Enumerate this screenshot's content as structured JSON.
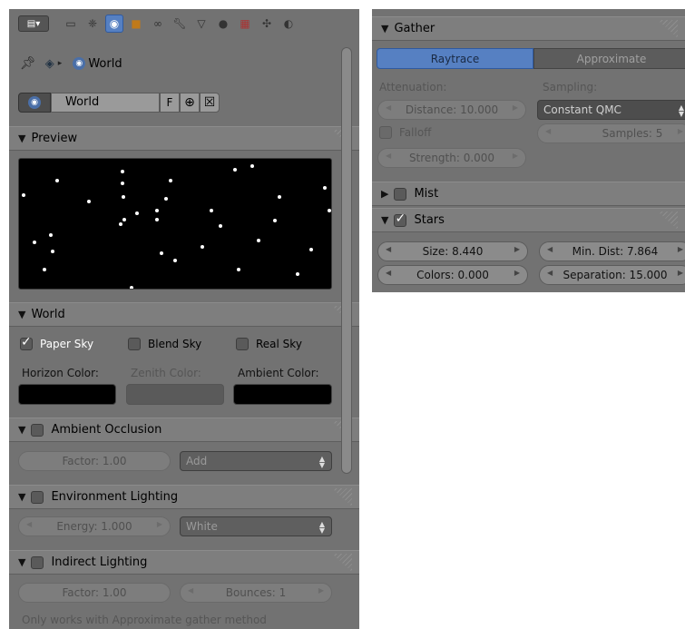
{
  "toolbar": {
    "tabs": [
      {
        "icon": "render-icon"
      },
      {
        "icon": "render-layers-icon"
      },
      {
        "icon": "scene-icon"
      },
      {
        "icon": "world-icon"
      },
      {
        "icon": "object-icon"
      },
      {
        "icon": "constraints-icon"
      },
      {
        "icon": "modifiers-icon"
      },
      {
        "icon": "mesh-data-icon"
      },
      {
        "icon": "material-icon"
      },
      {
        "icon": "texture-icon"
      },
      {
        "icon": "particles-icon"
      },
      {
        "icon": "physics-icon"
      }
    ],
    "active_tab": "world-icon"
  },
  "breadcrumb": {
    "item": "World"
  },
  "world_datablock": {
    "name": "World",
    "fake_user_label": "F"
  },
  "preview": {
    "title": "Preview"
  },
  "world": {
    "title": "World",
    "paper_sky": {
      "label": "Paper Sky",
      "checked": true
    },
    "blend_sky": {
      "label": "Blend Sky",
      "checked": false
    },
    "real_sky": {
      "label": "Real Sky",
      "checked": false
    },
    "horizon_label": "Horizon Color:",
    "zenith_label": "Zenith Color:",
    "ambient_label": "Ambient Color:",
    "colors": {
      "horizon": "#000000",
      "zenith": "#5a5a5a",
      "ambient": "#000000"
    }
  },
  "ambient_occlusion": {
    "title": "Ambient Occlusion",
    "factor": "Factor: 1.00",
    "blend": "Add"
  },
  "environment_lighting": {
    "title": "Environment Lighting",
    "energy": "Energy: 1.000",
    "color": "White"
  },
  "indirect_lighting": {
    "title": "Indirect Lighting",
    "factor": "Factor: 1.00",
    "bounces": "Bounces: 1",
    "note": "Only works with Approximate gather method"
  },
  "gather": {
    "title": "Gather",
    "tab_raytrace": "Raytrace",
    "tab_approximate": "Approximate",
    "attenuation_label": "Attenuation:",
    "sampling_label": "Sampling:",
    "distance": "Distance: 10.000",
    "sampling_method": "Constant QMC",
    "falloff_label": "Falloff",
    "samples": "Samples: 5",
    "strength": "Strength: 0.000"
  },
  "mist": {
    "title": "Mist",
    "checked": false
  },
  "stars": {
    "title": "Stars",
    "checked": true,
    "size": "Size: 8.440",
    "min_dist": "Min. Dist: 7.864",
    "colors": "Colors: 0.000",
    "separation": "Separation: 15.000"
  },
  "ui_colors": {
    "accent": "#5680c2",
    "panel": "#727272",
    "header": "#7e7e7e"
  }
}
